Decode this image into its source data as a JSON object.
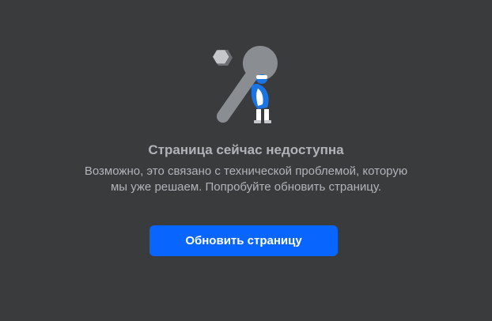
{
  "error": {
    "illustration_icon": "wrench-with-person-icon",
    "title": "Страница сейчас недоступна",
    "message": "Возможно, это связано с технической проблемой, которую мы уже решаем. Попробуйте обновить страницу.",
    "reload_button_label": "Обновить страницу"
  },
  "colors": {
    "background": "#3a3b3c",
    "text_secondary": "#b0b3b8",
    "accent": "#0866ff",
    "icon_gray": "#8a8d91",
    "figure_blue": "#1b74e4",
    "figure_white": "#ffffff"
  }
}
